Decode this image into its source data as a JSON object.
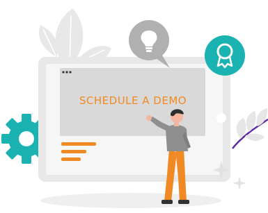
{
  "screen": {
    "title": "SCHEDULE A DEMO"
  },
  "colors": {
    "accent": "#f08a24",
    "teal": "#1ab3b1",
    "monitor": "#e7e7e7",
    "screen": "#dadada",
    "bubble": "#b0b0b0",
    "shadow": "#eeeeee",
    "leaf": "#e6e6e6",
    "vine": "#5b2ca0"
  },
  "icons": {
    "monitor_dots": "three-dots-icon",
    "lightbulb": "lightbulb-icon",
    "award": "award-badge-icon",
    "gear": "gear-icon",
    "leaf_left": "leaf-icon",
    "leaf_right": "leaf-icon",
    "sparkles": "sparkle-icon"
  }
}
